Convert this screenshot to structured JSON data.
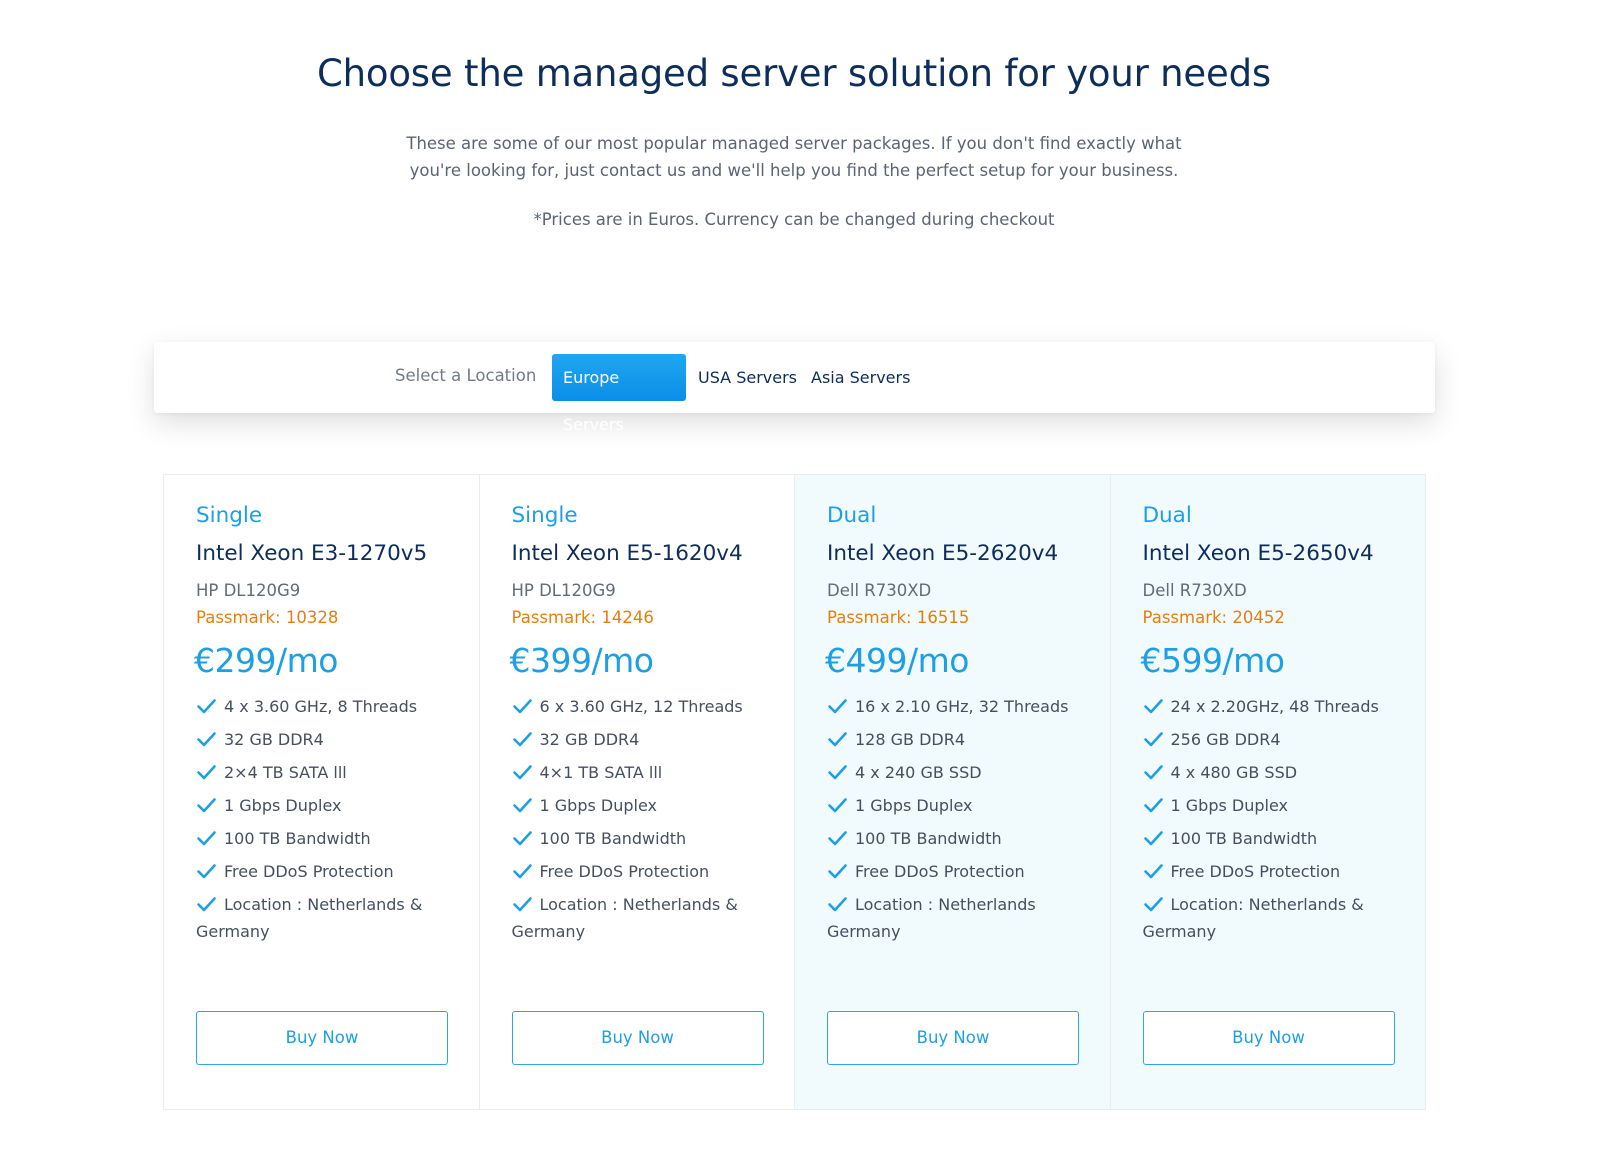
{
  "header": {
    "title": "Choose the managed server solution for your needs",
    "intro": "These are some of our most popular managed server packages. If you don't find exactly what you're looking for, just contact us and we'll help you find the perfect setup for your business.",
    "note": "*Prices are in Euros. Currency can be changed during checkout"
  },
  "location": {
    "label": "Select a Location",
    "tabs": [
      {
        "label": "Europe Servers",
        "active": true
      },
      {
        "label": "USA Servers",
        "active": false
      },
      {
        "label": "Asia Servers",
        "active": false
      }
    ]
  },
  "plans": [
    {
      "type": "Single",
      "cpu": "Intel Xeon E3-1270v5",
      "model": "HP DL120G9",
      "passmark": "Passmark: 10328",
      "price": "€299/mo",
      "features": [
        "4 x 3.60 GHz, 8 Threads",
        "32 GB DDR4",
        "2×4 TB SATA lll",
        "1 Gbps Duplex",
        "100 TB Bandwidth",
        "Free DDoS Protection",
        "Location : Netherlands & Germany"
      ],
      "button": "Buy Now"
    },
    {
      "type": "Single",
      "cpu": "Intel Xeon E5-1620v4",
      "model": "HP DL120G9",
      "passmark": "Passmark: 14246",
      "price": "€399/mo",
      "features": [
        "6 x 3.60 GHz, 12 Threads",
        "32 GB DDR4",
        "4×1 TB SATA lll",
        "1 Gbps Duplex",
        "100 TB Bandwidth",
        "Free DDoS Protection",
        "Location : Netherlands & Germany"
      ],
      "button": "Buy Now"
    },
    {
      "type": "Dual",
      "cpu": "Intel Xeon E5-2620v4",
      "model": "Dell R730XD",
      "passmark": "Passmark: 16515",
      "price": "€499/mo",
      "features": [
        "16 x 2.10 GHz, 32 Threads",
        "128 GB DDR4",
        "4 x 240 GB SSD",
        "1 Gbps Duplex",
        "100 TB Bandwidth",
        "Free DDoS Protection",
        "Location : Netherlands Germany"
      ],
      "button": "Buy Now"
    },
    {
      "type": "Dual",
      "cpu": "Intel Xeon E5-2650v4",
      "model": "Dell R730XD",
      "passmark": "Passmark: 20452",
      "price": "€599/mo",
      "features": [
        "24 x 2.20GHz, 48 Threads",
        "256 GB DDR4",
        "4 x 480 GB SSD",
        "1 Gbps Duplex",
        "100 TB Bandwidth",
        "Free DDoS Protection",
        "Location: Netherlands & Germany"
      ],
      "button": "Buy Now"
    }
  ],
  "colors": {
    "accent": "#1e9fe3",
    "title": "#0d2d5a",
    "passmark": "#e57f0a",
    "alt_card_bg": "#f1fafd"
  }
}
